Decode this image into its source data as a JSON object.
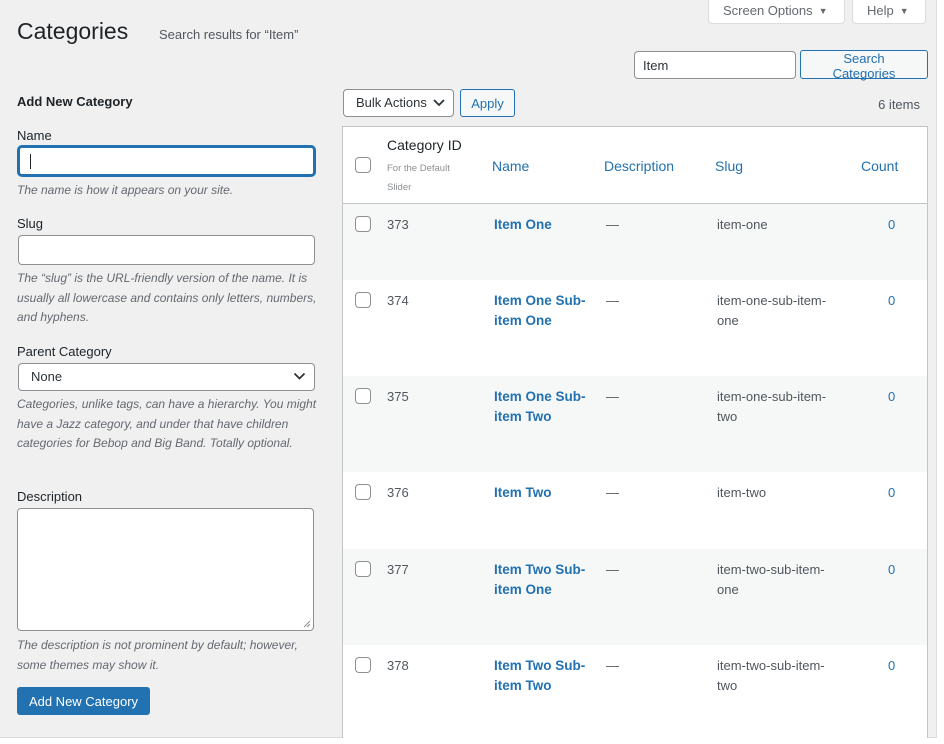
{
  "header": {
    "title": "Categories",
    "subtitle": "Search results for “Item”",
    "screen_options": "Screen Options",
    "help": "Help"
  },
  "search": {
    "value": "Item",
    "button": "Search Categories"
  },
  "form": {
    "heading": "Add New Category",
    "name_label": "Name",
    "name_value": "",
    "name_help": "The name is how it appears on your site.",
    "slug_label": "Slug",
    "slug_value": "",
    "slug_help": "The “slug” is the URL-friendly version of the name. It is usually all lowercase and contains only letters, numbers, and hyphens.",
    "parent_label": "Parent Category",
    "parent_selected": "None",
    "parent_help": "Categories, unlike tags, can have a hierarchy. You might have a Jazz category, and under that have children categories for Bebop and Big Band. Totally optional.",
    "description_label": "Description",
    "description_value": "",
    "description_help": "The description is not prominent by default; however, some themes may show it.",
    "submit": "Add New Category"
  },
  "toolbar": {
    "bulk_actions": "Bulk Actions",
    "apply": "Apply",
    "count": "6 items"
  },
  "table": {
    "columns": {
      "id": "Category ID",
      "id_note": "For the Default Slider",
      "name": "Name",
      "description": "Description",
      "slug": "Slug",
      "count": "Count"
    },
    "rows": [
      {
        "id": "373",
        "name": "Item One",
        "description": "—",
        "slug": "item-one",
        "count": "0"
      },
      {
        "id": "374",
        "name": "Item One Sub-item One",
        "description": "—",
        "slug": "item-one-sub-item-one",
        "count": "0"
      },
      {
        "id": "375",
        "name": "Item One Sub-item Two",
        "description": "—",
        "slug": "item-one-sub-item-two",
        "count": "0"
      },
      {
        "id": "376",
        "name": "Item Two",
        "description": "—",
        "slug": "item-two",
        "count": "0"
      },
      {
        "id": "377",
        "name": "Item Two Sub-item One",
        "description": "—",
        "slug": "item-two-sub-item-one",
        "count": "0"
      },
      {
        "id": "378",
        "name": "Item Two Sub-item Two",
        "description": "—",
        "slug": "item-two-sub-item-two",
        "count": "0"
      }
    ]
  },
  "colors": {
    "accent": "#2271b1",
    "background": "#f0f0f1",
    "row_alt": "#f6f7f7"
  }
}
